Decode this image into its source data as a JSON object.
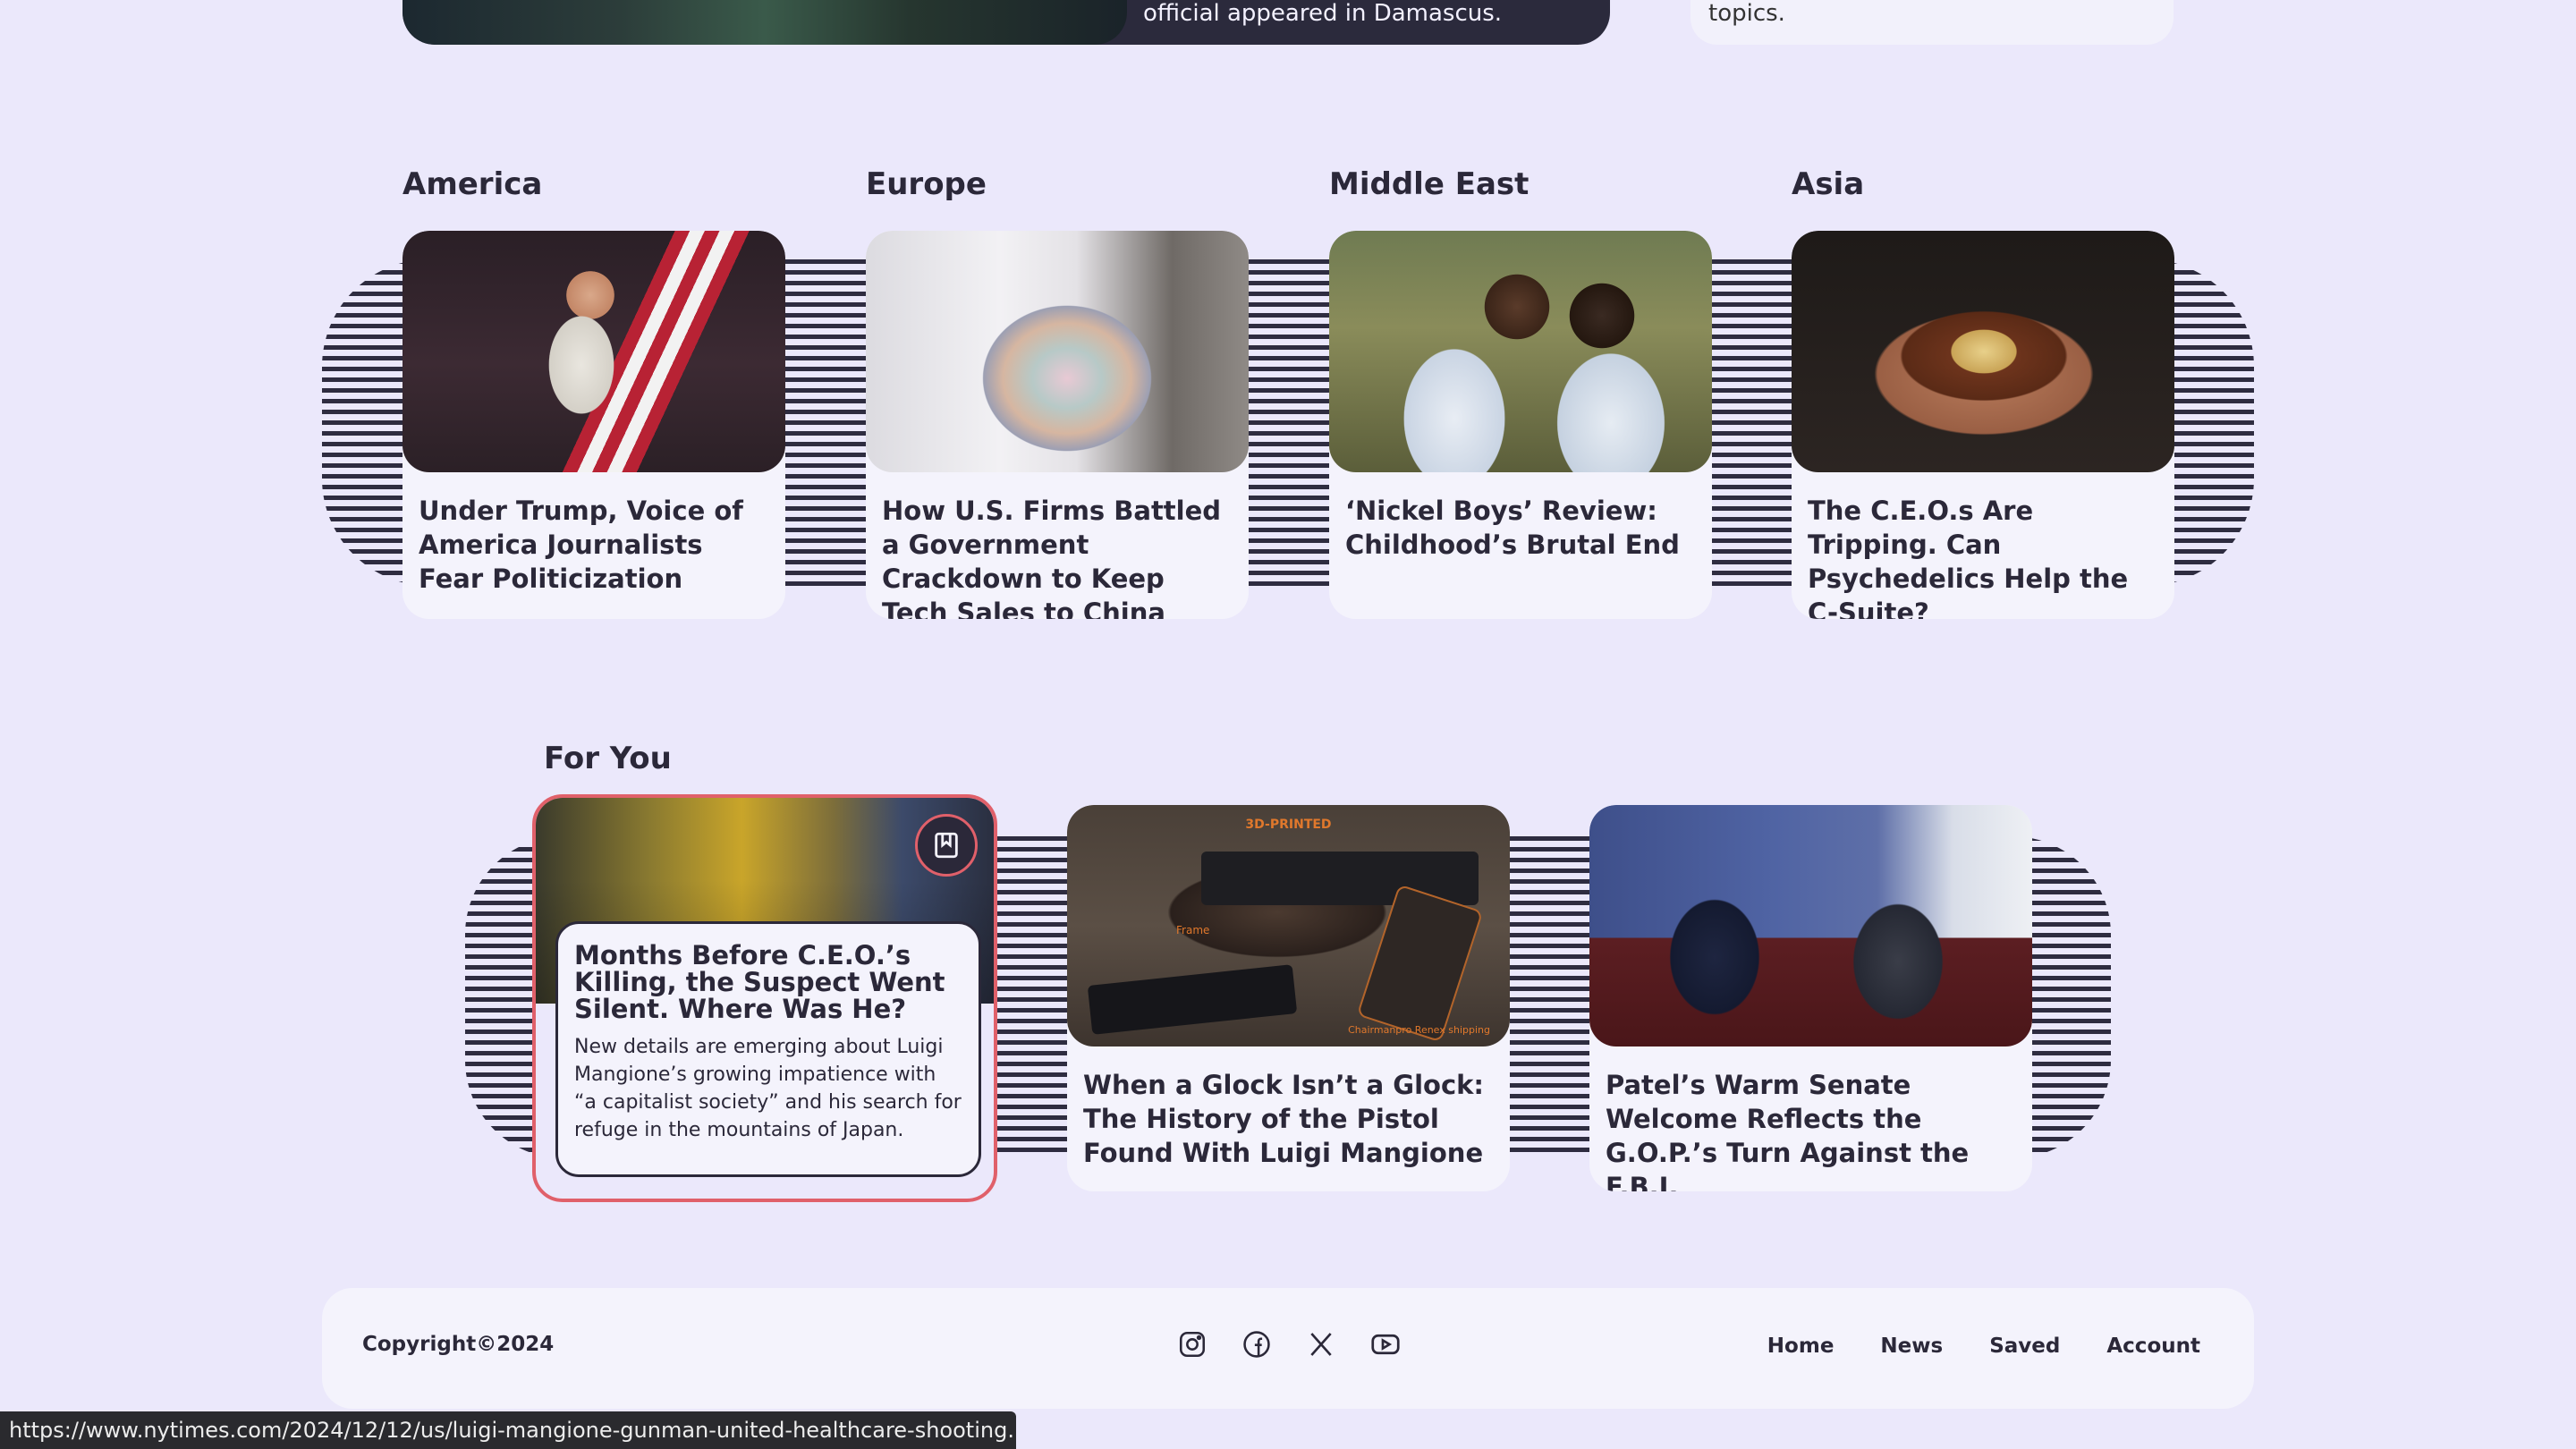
{
  "top": {
    "left_card_text": "official appeared in Damascus.",
    "right_card_text": "topics."
  },
  "regions": [
    {
      "title": "America",
      "headline": "Under Trump, Voice of America Journalists Fear Politicization"
    },
    {
      "title": "Europe",
      "headline": "How U.S. Firms Battled a Government Crackdown to Keep Tech Sales to China"
    },
    {
      "title": "Middle East",
      "headline": "‘Nickel Boys’ Review: Childhood’s Brutal End"
    },
    {
      "title": "Asia",
      "headline": "The C.E.O.s Are Tripping. Can Psychedelics Help the C-Suite?"
    }
  ],
  "for_you": {
    "title": "For You",
    "featured": {
      "headline": "Months Before C.E.O.’s Killing, the Suspect Went Silent. Where Was He?",
      "summary": "New details are emerging about Luigi Mangione’s growing impatience with “a capitalist society” and his search for refuge in the mountains of Japan."
    },
    "cards": [
      {
        "headline": "When a Glock Isn’t a Glock: The History of the Pistol Found With Luigi Mangione",
        "image_label": "3D-PRINTED",
        "image_sublabel": "Frame",
        "image_credit": "Chairmanpro Renex shipping"
      },
      {
        "headline": "Patel’s Warm Senate Welcome Reflects the G.O.P.’s Turn Against the F.B.I."
      }
    ]
  },
  "footer": {
    "copyright": "Copyright©2024",
    "socials": [
      "instagram-icon",
      "facebook-icon",
      "x-icon",
      "youtube-icon"
    ],
    "nav": [
      "Home",
      "News",
      "Saved",
      "Account"
    ]
  },
  "status_url": "https://www.nytimes.com/2024/12/12/us/luigi-mangione-gunman-united-healthcare-shooting.html",
  "colors": {
    "background": "#ebe8fb",
    "card": "#f4f3fc",
    "dark": "#2b2839",
    "highlight": "#e0606a"
  }
}
